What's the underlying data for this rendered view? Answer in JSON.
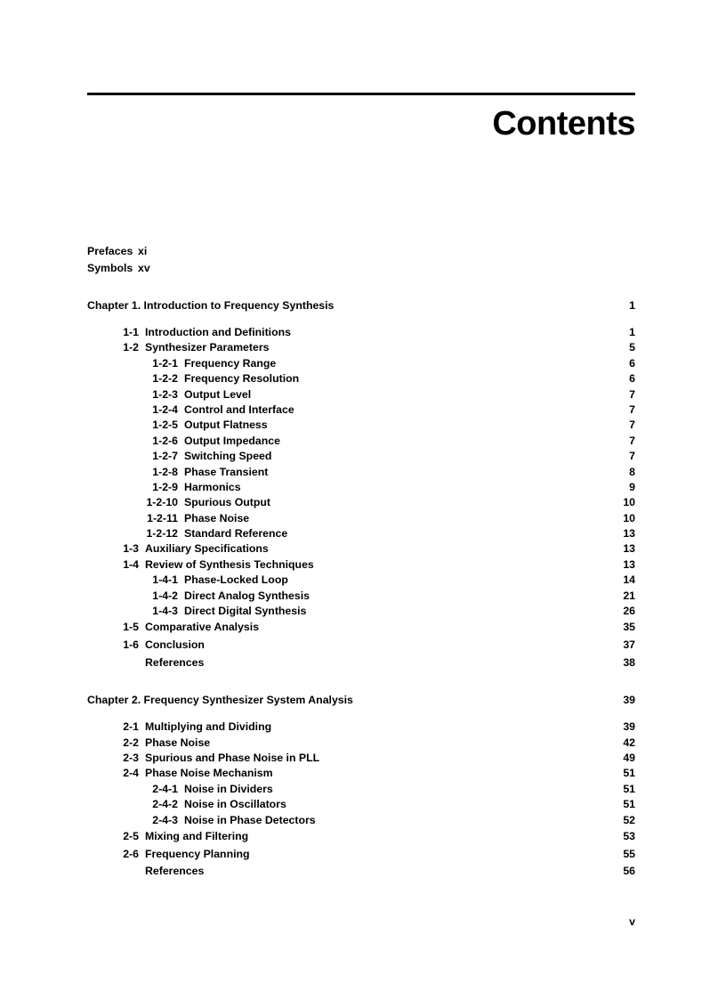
{
  "header": {
    "title": "Contents"
  },
  "front_matter": [
    {
      "label": "Prefaces",
      "page": "xi"
    },
    {
      "label": "Symbols",
      "page": "xv"
    }
  ],
  "chapters": [
    {
      "heading": "Chapter 1.  Introduction to Frequency Synthesis",
      "page": "1",
      "entries": [
        {
          "level": 1,
          "num": "1-1",
          "label": "Introduction and Definitions",
          "page": "1"
        },
        {
          "level": 1,
          "num": "1-2",
          "label": "Synthesizer Parameters",
          "page": "5"
        },
        {
          "level": 2,
          "num": "1-2-1",
          "label": "Frequency Range",
          "page": "6"
        },
        {
          "level": 2,
          "num": "1-2-2",
          "label": "Frequency Resolution",
          "page": "6"
        },
        {
          "level": 2,
          "num": "1-2-3",
          "label": "Output Level",
          "page": "7"
        },
        {
          "level": 2,
          "num": "1-2-4",
          "label": "Control and Interface",
          "page": "7"
        },
        {
          "level": 2,
          "num": "1-2-5",
          "label": "Output Flatness",
          "page": "7"
        },
        {
          "level": 2,
          "num": "1-2-6",
          "label": "Output Impedance",
          "page": "7"
        },
        {
          "level": 2,
          "num": "1-2-7",
          "label": "Switching Speed",
          "page": "7"
        },
        {
          "level": 2,
          "num": "1-2-8",
          "label": "Phase Transient",
          "page": "8"
        },
        {
          "level": 2,
          "num": "1-2-9",
          "label": "Harmonics",
          "page": "9"
        },
        {
          "level": 2,
          "num": "1-2-10",
          "label": "Spurious Output",
          "page": "10"
        },
        {
          "level": 2,
          "num": "1-2-11",
          "label": "Phase Noise",
          "page": "10"
        },
        {
          "level": 2,
          "num": "1-2-12",
          "label": "Standard Reference",
          "page": "13"
        },
        {
          "level": 1,
          "num": "1-3",
          "label": "Auxiliary Specifications",
          "page": "13"
        },
        {
          "level": 1,
          "num": "1-4",
          "label": "Review of Synthesis Techniques",
          "page": "13"
        },
        {
          "level": 2,
          "num": "1-4-1",
          "label": "Phase-Locked Loop",
          "page": "14"
        },
        {
          "level": 2,
          "num": "1-4-2",
          "label": "Direct Analog Synthesis",
          "page": "21"
        },
        {
          "level": 2,
          "num": "1-4-3",
          "label": "Direct Digital Synthesis",
          "page": "26"
        },
        {
          "level": 1,
          "num": "1-5",
          "label": "Comparative Analysis",
          "page": "35",
          "loose": true
        },
        {
          "level": 1,
          "num": "1-6",
          "label": "Conclusion",
          "page": "37",
          "loose": true
        },
        {
          "level": 1,
          "num": "",
          "label": "References",
          "page": "38",
          "loose": true
        }
      ]
    },
    {
      "heading": "Chapter 2.  Frequency Synthesizer System Analysis",
      "page": "39",
      "entries": [
        {
          "level": 1,
          "num": "2-1",
          "label": "Multiplying and Dividing",
          "page": "39"
        },
        {
          "level": 1,
          "num": "2-2",
          "label": "Phase Noise",
          "page": "42"
        },
        {
          "level": 1,
          "num": "2-3",
          "label": "Spurious and Phase Noise in PLL",
          "page": "49"
        },
        {
          "level": 1,
          "num": "2-4",
          "label": "Phase Noise Mechanism",
          "page": "51"
        },
        {
          "level": 2,
          "num": "2-4-1",
          "label": "Noise in Dividers",
          "page": "51"
        },
        {
          "level": 2,
          "num": "2-4-2",
          "label": "Noise in Oscillators",
          "page": "51"
        },
        {
          "level": 2,
          "num": "2-4-3",
          "label": "Noise in Phase Detectors",
          "page": "52"
        },
        {
          "level": 1,
          "num": "2-5",
          "label": "Mixing and Filtering",
          "page": "53",
          "loose": true
        },
        {
          "level": 1,
          "num": "2-6",
          "label": "Frequency Planning",
          "page": "55",
          "loose": true
        },
        {
          "level": 1,
          "num": "",
          "label": "References",
          "page": "56",
          "loose": true
        }
      ]
    }
  ],
  "folio": "v"
}
